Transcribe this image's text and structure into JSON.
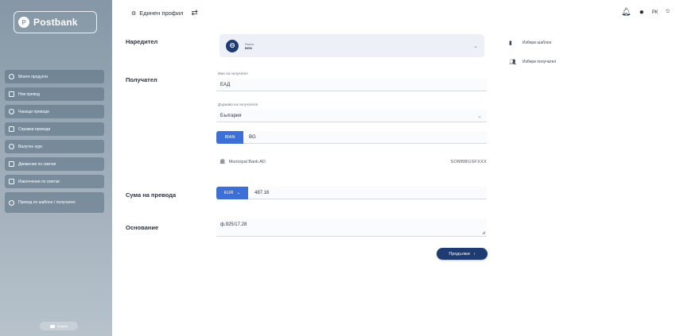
{
  "sidebar": {
    "logo_text": "Postbank",
    "logo_subtitle": "",
    "items": [
      {
        "label": "Моите продукти",
        "icon": "home-icon"
      },
      {
        "label": "Нов превод",
        "icon": "transfer-icon"
      },
      {
        "label": "Чакащи преводи",
        "icon": "clock-icon"
      },
      {
        "label": "Справки преводи",
        "icon": "report-icon"
      },
      {
        "label": "Валутен курс",
        "icon": "currency-icon"
      },
      {
        "label": "Движения по сметки",
        "icon": "movements-icon"
      },
      {
        "label": "Извлечения по сметки",
        "icon": "statement-icon"
      },
      {
        "label": "Превод по шаблон / получател",
        "icon": "template-icon"
      }
    ],
    "lang_label": "English"
  },
  "topbar": {
    "profile_label": "Единен профил",
    "right_text": "РК"
  },
  "form": {
    "payer_label": "Наредител",
    "payer": {
      "account_type_1": "Разпл.",
      "account_type_2": "BGN",
      "iban": "",
      "balance_caption": "",
      "balance": ""
    },
    "recipient_label": "Получател",
    "recipient_name_caption": "Име на получател",
    "recipient_name": "ЕАД",
    "country_caption": "Държава на получателя",
    "country": "България",
    "iban_tag": "IBAN",
    "iban_value": "BG",
    "bank_name": "Municipal Bank AD",
    "bank_bic": "SOMBBGSFXXX",
    "amount_label": "Сума на превода",
    "currency": "EUR",
    "amount": "487.16",
    "reason_label": "Основание",
    "reason": "ф.925/17.28",
    "continue_label": "Продължи"
  },
  "quick_links": [
    {
      "label": "Избери шаблон",
      "icon": "template-icon"
    },
    {
      "label": "Избери получател",
      "icon": "users-icon"
    }
  ],
  "colors": {
    "primary": "#1e3c72",
    "accent": "#3d70d6",
    "sidebar": "#8597a6"
  }
}
